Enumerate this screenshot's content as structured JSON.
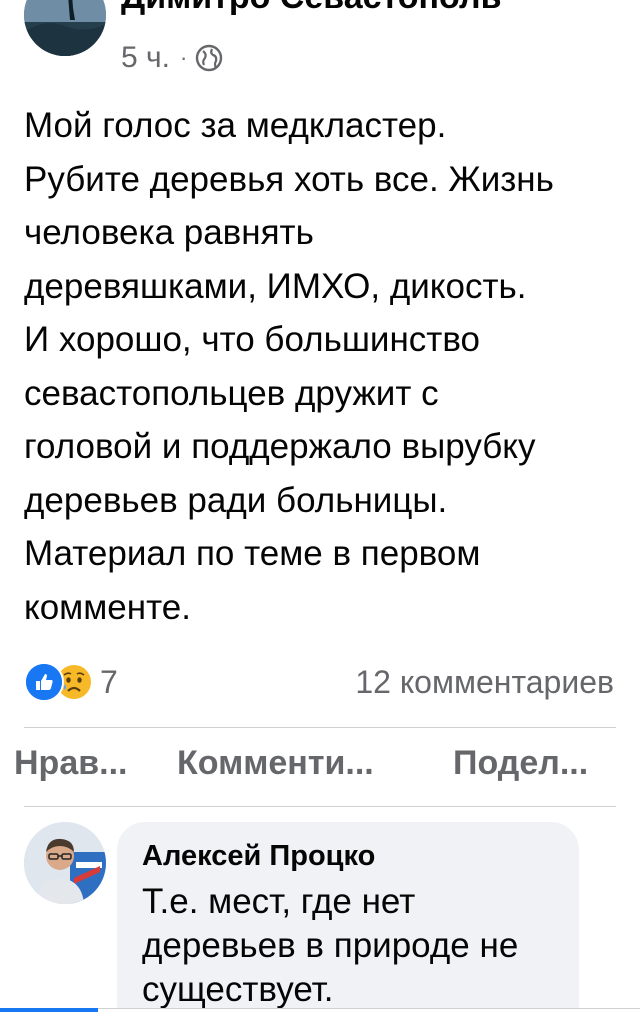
{
  "post": {
    "author": "Димитро Севастополь",
    "time": "5 ч.",
    "separator": "·",
    "privacy_icon": "globe-icon",
    "text_lines": [
      "Мой голос за медкластер.",
      "Рубите деревья хоть все. Жизнь",
      "человека равнять",
      "деревяшками, ИМХО, дикость.",
      "И хорошо, что большинство",
      "севастопольцев дружит с",
      "головой и поддержало вырубку",
      "деревьев ради больницы.",
      "Материал по теме в первом",
      "комменте."
    ]
  },
  "reactions": {
    "icons": [
      "like-icon",
      "sad-icon"
    ],
    "count": "7",
    "comments_count": "12 комментариев"
  },
  "actions": {
    "like_label": "Нрав...",
    "comment_label": "Комменти...",
    "share_label": "Подел..."
  },
  "comment": {
    "author": "Алексей Процко",
    "text_lines": [
      "Т.е. мест, где нет",
      "деревьев в природе не",
      "существует."
    ]
  },
  "colors": {
    "accent": "#1877f2",
    "secondary_text": "#65676b",
    "bubble": "#f0f2f5",
    "sad_reaction": "#f7b928"
  }
}
